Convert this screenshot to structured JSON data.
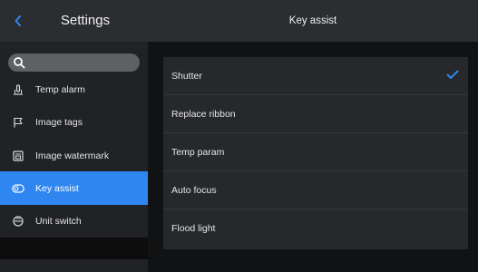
{
  "sidebar": {
    "title": "Settings",
    "back_icon": "chevron-left-icon",
    "search": {
      "placeholder": "",
      "icon": "search-icon"
    },
    "items": [
      {
        "label": "Temp alarm",
        "icon": "thermometer-icon"
      },
      {
        "label": "Image tags",
        "icon": "flag-icon"
      },
      {
        "label": "Image watermark",
        "icon": "watermark-icon"
      },
      {
        "label": "Key assist",
        "icon": "key-assist-icon",
        "active": true
      },
      {
        "label": "Unit switch",
        "icon": "unit-switch-icon"
      }
    ]
  },
  "main": {
    "title": "Key assist",
    "options": [
      {
        "label": "Shutter",
        "selected": true
      },
      {
        "label": "Replace ribbon",
        "selected": false
      },
      {
        "label": "Temp param",
        "selected": false
      },
      {
        "label": "Auto focus",
        "selected": false
      },
      {
        "label": "Flood light",
        "selected": false
      }
    ]
  },
  "colors": {
    "accent": "#2f86f0",
    "sidebar_bg": "#202226",
    "header_bg": "#2b2d31",
    "panel_bg": "#26282b",
    "page_bg": "#111214"
  }
}
